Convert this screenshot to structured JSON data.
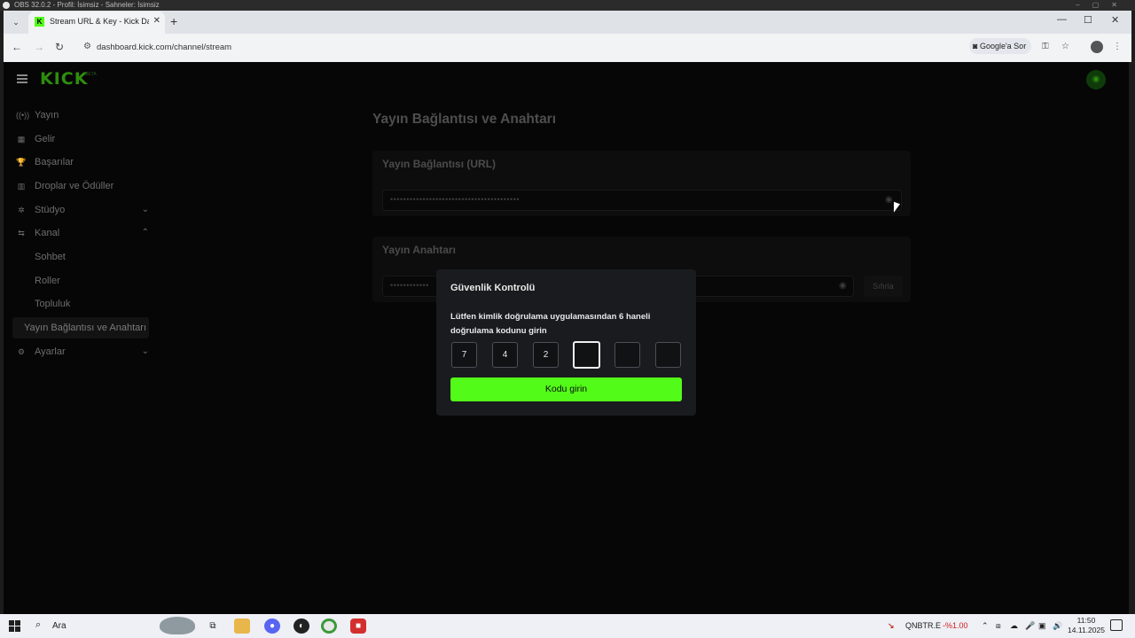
{
  "obs": {
    "title": "OBS 32.0.2 - Profil: İsimsiz - Sahneler: İsimsiz"
  },
  "browser": {
    "tab_title": "Stream URL & Key - Kick Dashb",
    "url": "dashboard.kick.com/channel/stream",
    "google_ask": "Google'a Sor"
  },
  "sidebar": {
    "items": [
      {
        "label": "Yayın",
        "icon": "broadcast-icon"
      },
      {
        "label": "Gelir",
        "icon": "revenue-icon"
      },
      {
        "label": "Başarılar",
        "icon": "trophy-icon"
      },
      {
        "label": "Droplar ve Ödüller",
        "icon": "drops-icon"
      },
      {
        "label": "Stüdyo",
        "icon": "studio-icon"
      },
      {
        "label": "Kanal",
        "icon": "channel-icon"
      },
      {
        "label": "Sohbet"
      },
      {
        "label": "Roller"
      },
      {
        "label": "Topluluk"
      },
      {
        "label": "Yayın Bağlantısı ve Anahtarı"
      },
      {
        "label": "Ayarlar",
        "icon": "gear-icon"
      }
    ]
  },
  "main": {
    "page_title": "Yayın Bağlantısı ve Anahtarı",
    "url_card": {
      "title": "Yayın Bağlantısı (URL)",
      "masked_value": "••••••••••••••••••••••••••••••••••••••••"
    },
    "key_card": {
      "title": "Yayın Anahtarı",
      "masked_value": "••••••••••••",
      "reset_label": "Sıfırla"
    }
  },
  "modal": {
    "title": "Güvenlik Kontrolü",
    "instruction": "Lütfen kimlik doğrulama uygulamasından 6 haneli doğrulama kodunu girin",
    "code_digits": [
      "7",
      "4",
      "2",
      "",
      "",
      ""
    ],
    "submit_label": "Kodu girin"
  },
  "taskbar": {
    "search_text": "Ara",
    "ticker_name": "QNBTR.E",
    "ticker_change": "-%1.00",
    "time": "11:50",
    "date": "14.11.2025"
  },
  "colors": {
    "kick_green": "#53fc18",
    "ticker_negative": "#d02020"
  }
}
